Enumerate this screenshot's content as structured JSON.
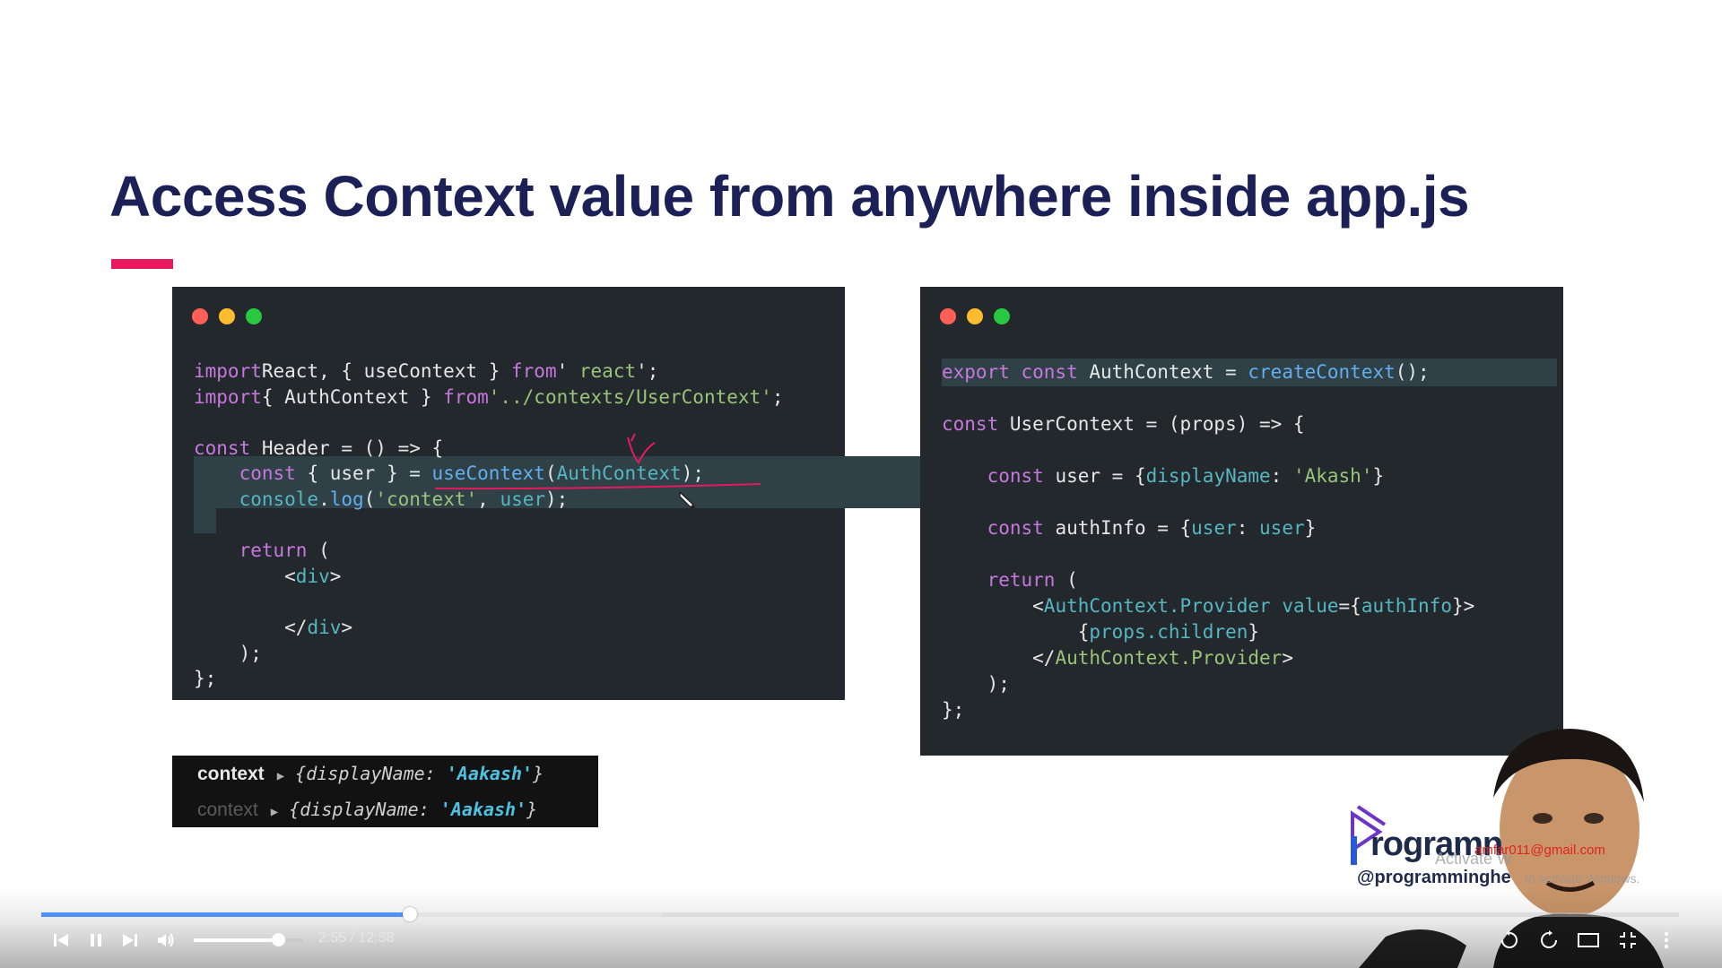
{
  "slide": {
    "title": "Access Context value from anywhere inside app.js",
    "accent_color": "#e8195f"
  },
  "left_code": {
    "lines": [
      [
        [
          "k",
          "import"
        ],
        [
          "",
          "React, { useContext } "
        ],
        [
          "k",
          "from"
        ],
        [
          "",
          "' "
        ],
        [
          "s",
          "react"
        ],
        [
          "",
          "';"
        ]
      ],
      [
        [
          "k",
          "import"
        ],
        [
          "",
          "{ AuthContext } "
        ],
        [
          "k",
          "from"
        ],
        [
          "s",
          "'../contexts/UserContext'"
        ],
        [
          "",
          ";"
        ]
      ],
      [],
      [
        [
          "k",
          "const "
        ],
        [
          "",
          "Header = () => {"
        ]
      ],
      [
        [
          "",
          "    "
        ],
        [
          "k",
          "const "
        ],
        [
          "",
          "{ user } = "
        ],
        [
          "f",
          "useContext"
        ],
        [
          "",
          "("
        ],
        [
          "t",
          "AuthContext"
        ],
        [
          "",
          ");"
        ]
      ],
      [
        [
          "",
          "    "
        ],
        [
          "t",
          "console"
        ],
        [
          "",
          "."
        ],
        [
          "f",
          "log"
        ],
        [
          "",
          "("
        ],
        [
          "s",
          "'context'"
        ],
        [
          "",
          ", "
        ],
        [
          "t",
          "user"
        ],
        [
          "",
          ");"
        ]
      ],
      [],
      [
        [
          "",
          "    "
        ],
        [
          "k",
          "return "
        ],
        [
          "",
          "("
        ]
      ],
      [
        [
          "",
          "        <"
        ],
        [
          "t",
          "div"
        ],
        [
          "",
          ">"
        ]
      ],
      [],
      [
        [
          "",
          "        </"
        ],
        [
          "t",
          "div"
        ],
        [
          "",
          ">"
        ]
      ],
      [
        [
          "",
          "    );"
        ]
      ],
      [
        [
          "",
          "};"
        ]
      ]
    ]
  },
  "right_code": {
    "lines": [
      [
        [
          "k",
          "export const "
        ],
        [
          "",
          "AuthContext = "
        ],
        [
          "f",
          "createContext"
        ],
        [
          "",
          "();"
        ]
      ],
      [],
      [
        [
          "k",
          "const "
        ],
        [
          "",
          "UserContext = (props) => {"
        ]
      ],
      [],
      [
        [
          "",
          "    "
        ],
        [
          "k",
          "const "
        ],
        [
          "",
          "user = {"
        ],
        [
          "t",
          "displayName"
        ],
        [
          "",
          ": "
        ],
        [
          "s",
          "'Akash'"
        ],
        [
          "",
          "}"
        ]
      ],
      [],
      [
        [
          "",
          "    "
        ],
        [
          "k",
          "const "
        ],
        [
          "",
          "authInfo = {"
        ],
        [
          "t",
          "user"
        ],
        [
          "",
          ": "
        ],
        [
          "t",
          "user"
        ],
        [
          "",
          "}"
        ]
      ],
      [],
      [
        [
          "",
          "    "
        ],
        [
          "k",
          "return "
        ],
        [
          "",
          "("
        ]
      ],
      [
        [
          "",
          "        <"
        ],
        [
          "t",
          "AuthContext.Provider"
        ],
        [
          "",
          ""
        ],
        [
          "t",
          " value"
        ],
        [
          "",
          "={"
        ],
        [
          "t",
          "authInfo"
        ],
        [
          "",
          "}>"
        ]
      ],
      [
        [
          "",
          "            {"
        ],
        [
          "t",
          "props.children"
        ],
        [
          "",
          "}"
        ]
      ],
      [
        [
          "",
          "        </"
        ],
        [
          "s",
          "AuthContext.Provider"
        ],
        [
          "",
          ">"
        ]
      ],
      [
        [
          "",
          "    );"
        ]
      ],
      [
        [
          "",
          "};"
        ]
      ]
    ]
  },
  "console": {
    "rows": [
      {
        "label": "context",
        "arrow": "▶",
        "obj_open": "{displayName: ",
        "value": "'Aakash'",
        "obj_close": "}"
      },
      {
        "label": "context",
        "arrow": "▶",
        "obj_open": "{displayName: ",
        "value": "'Aakash'",
        "obj_close": "}"
      }
    ]
  },
  "branding": {
    "word": "rogramn",
    "handle": "@programminghe",
    "email": "amfar011@gmail.com",
    "watermark_line1": "Activate W",
    "watermark_line2": "to activate Windows."
  },
  "player": {
    "time": "2:55 / 12:58",
    "progress": 0.225,
    "buffered": 0.379,
    "volume": 0.77,
    "icons": [
      "previous-icon",
      "pause-icon",
      "next-icon",
      "volume-icon",
      "rewind-10-icon",
      "forward-10-icon",
      "theater-mode-icon",
      "exit-fullscreen-icon",
      "more-options-icon"
    ]
  }
}
